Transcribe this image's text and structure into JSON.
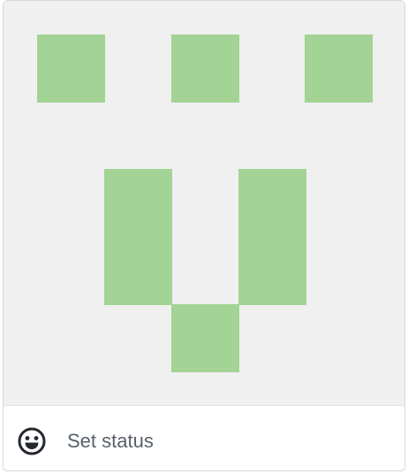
{
  "identicon": {
    "background_color": "#f0f0f0",
    "pixel_color": "#a3d395"
  },
  "status": {
    "icon": "smiley-icon",
    "label": "Set status"
  }
}
